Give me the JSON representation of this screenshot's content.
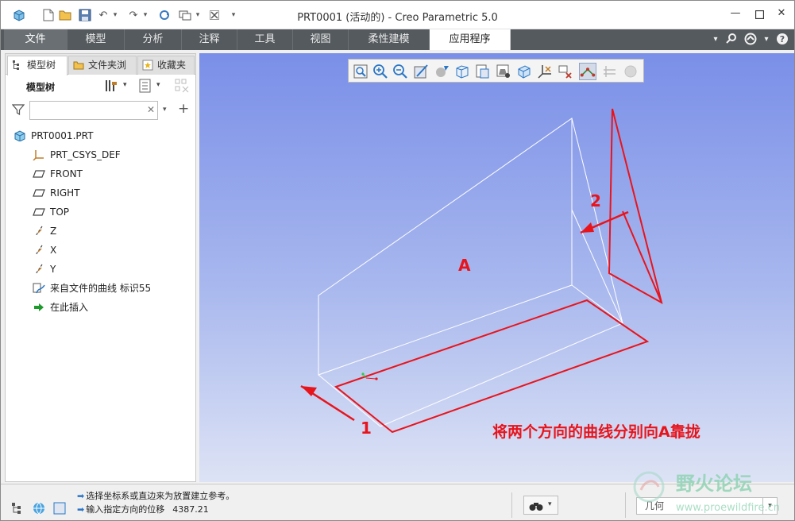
{
  "window": {
    "title": "PRT0001 (活动的) - Creo Parametric 5.0"
  },
  "ribbon": {
    "tabs": [
      {
        "label": "文件"
      },
      {
        "label": "模型"
      },
      {
        "label": "分析"
      },
      {
        "label": "注释"
      },
      {
        "label": "工具"
      },
      {
        "label": "视图"
      },
      {
        "label": "柔性建模"
      },
      {
        "label": "应用程序"
      }
    ],
    "active_tab": "应用程序"
  },
  "left_panel": {
    "tabs": [
      {
        "label": "模型树"
      },
      {
        "label": "文件夹浏"
      },
      {
        "label": "收藏夹"
      }
    ],
    "tree_header": "模型树",
    "filter_placeholder": "",
    "tree": [
      {
        "label": "PRT0001.PRT",
        "icon": "part-icon"
      },
      {
        "label": "PRT_CSYS_DEF",
        "icon": "csys-icon"
      },
      {
        "label": "FRONT",
        "icon": "datum-plane-icon"
      },
      {
        "label": "RIGHT",
        "icon": "datum-plane-icon"
      },
      {
        "label": "TOP",
        "icon": "datum-plane-icon"
      },
      {
        "label": "Z",
        "icon": "datum-axis-icon"
      },
      {
        "label": "X",
        "icon": "datum-axis-icon"
      },
      {
        "label": "Y",
        "icon": "datum-axis-icon"
      },
      {
        "label": "来自文件的曲线 标识55",
        "icon": "curve-from-file-icon"
      },
      {
        "label": "在此插入",
        "icon": "insert-here-icon"
      }
    ]
  },
  "viewport": {
    "annotations": {
      "face_label": "A",
      "arrow1_label": "1",
      "arrow2_label": "2",
      "caption": "将两个方向的曲线分别向A靠拢"
    },
    "colors": {
      "annotation": "#e8141c",
      "wireframe": "#ffffff",
      "background_top": "#7a8fe8",
      "background_bottom": "#dde3f5"
    }
  },
  "status_bar": {
    "messages": [
      "选择坐标系或直边来为放置建立参考。",
      "输入指定方向的位移"
    ],
    "value": "4387.21",
    "filter_value": "几何"
  },
  "watermark": {
    "text": "野火论坛",
    "url": "www.proewildfire.cn"
  }
}
